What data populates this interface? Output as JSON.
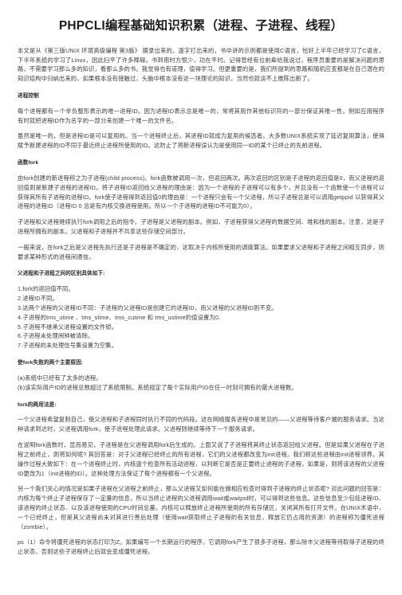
{
  "document": {
    "title": "PHPCLI编程基础知识积累（进程、子进程、线程）",
    "intro": "本文是从《第三版UNIX 环境高级编程 第3版》 摘录出来的。逐字打出来的，书中讲的示例都是使用C语言，恰好上半年已经学习了C语言，下半年系统的学习了Linux，因此扫平了许多障碍。书到用时方恨少，功在平时。记得曾经有位前辈给我说过，程序员重要的是解决问题的思路，不需要学习那么多的知识，看那么多的书。我觉得也有道理，值得学习。但更重要的是，我们所提到的思路和随机应变都是在自己潜在的知识结构中归纳出来的，如果根本没有接触过，头脑中根本没有这一块理论的知识，当然也就谈不上推陈出新了。",
    "sections": [
      {
        "heading": "进程控制",
        "paragraphs": [
          "每个进程都有一个非负整形表示的唯一进程ID。因为进程ID表示总是唯一的，常将其用作其他标识符的一部分保证其唯一性。例如应用程序有时就把进程ID作为名字的一部分来创建一个唯一的文件名。",
          "虽然是唯一的，但是进程ID是可以复用的。当一个进程终止后，其进程ID就成为复用的候选者。大多数UNIX系统实现了延迟复用算法，使得赋予新建进程的ID不同于最近终止进程所使用的ID。这防止了将新进程误认为是使用同一ID的某个已终止的先前进程。"
        ]
      },
      {
        "heading": "函数fork",
        "paragraphs": [
          "由fork创建的新进程称之为子进程(child process)。fork函数被调用一次，但返回两次。两次返回的区别是子进程的返回值是0，而父进程的返回值则是新建子进程的进程ID。将子进程ID返回给父进程的理由是：因为一个进程的子进程可以有多个，并且没有一个函数使一个进程可以获得其所有子进程的进程ID。fork使子进程得到返回值0的理由是：一个进程只会有一个父进程，所以子进程总是可以调用getppid 以获得其父进程的进程ID（进程ID 0 总是有内核交换进程使用。所以一个子进程的进程ID不可能为0）。",
          "子进程和父进程继续执行fork调用之后的指令。子进程是父进程的副本。例如，子进程获得父进程的数据空间、堆和栈的副本。注意，这是子进程所拥有的副本。父进程和子进程并不共享这些存储空间部分。",
          "一般来说，在fork之后是父进程先执行还是子进程是不确定的，这取决于内核所使用的调度算法。如果要求父进程和子进程之间相互同步，则要求某种形式的进程间通信。"
        ]
      }
    ],
    "diff_list": {
      "heading": "父进程和子进程之间的区别具体如下:",
      "items": [
        "1.fork的返回值不同。",
        "2.进程ID不同。",
        "3.这两个进程的父进程ID不同：子进程的父进程ID是创建它的进程ID，而父进程的父进程ID则不变。",
        "4.子进程的tms_utime 、tms_stime、tms_cutime 和 tms_ustime的值设置为0.",
        "5.子进程不继承父进程设置的文件锁。",
        "6.子进程未处理闹钟被清除。",
        "7.子进程的未处理信号集设置为空集。"
      ]
    },
    "fail_list": {
      "heading": "使fork失败的两个主要原因:",
      "items": [
        "(a)系统中已经有了太多的进程。",
        "(b)该实际用户ID的进程总数超过了系统限制。系统规定了每个实际用户ID在任一时刻可拥有的最大进程数。"
      ]
    },
    "usage": {
      "heading": "fork的两用法是:",
      "paragraphs": [
        "一个父进程希望复制自己，使父进程和子进程同时执行不同的代码段。这在网络服务进程中是常见的——父进程等待客户端的服务请求。当这种请求到达时，父进程调用fork，使子进程处理此请求。父进程则继续等待下一个服务请求。",
        "在说明fork函数时，显而易见，子进程是在父进程调用fork后生成的。上面又说了子进程将其终止状态返回给父进程。但是如果父进程在子进程之前终止，则将如何呢? 其回答是：对于父进程已经终止的所有进程，它们的父进程都改变为init进程。我们称这些进程由init进程领养。其操作过程大致如下：在一个进程终止时，内核逐个检查所有活动进程，以判断它是否是正要终止进程的子进程，如果是，则将该进程的父进程ID更改为1（init进程的ID）。这种处理方法保证了每个进程都有一个父进程。",
        "另一个我们关心的情况是如果子进程在父进程之前终止，那么父进程又如何能在做相应检查时得到子进程的终止状态呢? 对此问题的回答是：内核为每个终止子进程保存了一定量的信息，所以当终止进程的父进程调用wait或waitpid时，可以得到这些信息。这些信息至少包括进程ID、该进程的终止状态、以及该进程使用的CPU时间总量。内核可以释放终止进程所使用的所有存储区，关闭其所有打开文件。在UNIX术语中，一个已经终止，但是其父进程尚未对其进行善后处理（使用wait获取终止子进程的有关信息，释放它仍占用的资源）的进程称为僵死进程（zombie）。",
        "ps（1）命令将僵死进程的状态打印为Z。如果编写一个长期运行的程序，它调用fork产生了很多子进程，那么除丰父进程等待取得子进程的终止状态，否则这些子进程终止后就会变成僵死进程。"
      ]
    }
  }
}
